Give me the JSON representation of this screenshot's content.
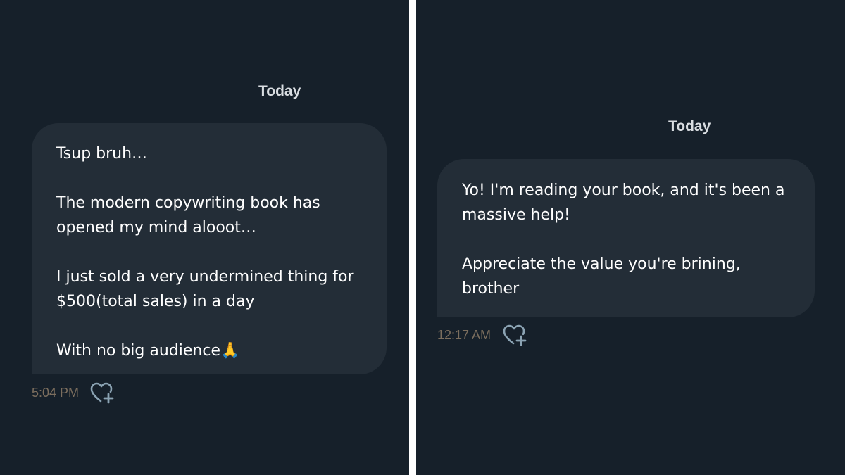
{
  "left": {
    "date_separator": "Today",
    "message": {
      "text": "Tsup bruh…\n\nThe modern copywriting book has opened my mind alooot…\n\nI just sold a very undermined thing for $500(total sales) in a day\n\nWith no big audience🙏",
      "timestamp": "5:04 PM"
    }
  },
  "right": {
    "date_separator": "Today",
    "message": {
      "text": "Yo! I'm reading your book, and it's been a massive help!\n\nAppreciate the value you're brining, brother",
      "timestamp": "12:17 AM"
    }
  },
  "icons": {
    "reaction": "heart-plus-icon"
  },
  "colors": {
    "background": "#16202a",
    "bubble": "#232d37",
    "text": "#ffffff",
    "date_label": "#d9dde1",
    "timestamp": "#7c6e5e",
    "icon": "#8ba3b3",
    "divider": "#ffffff"
  }
}
